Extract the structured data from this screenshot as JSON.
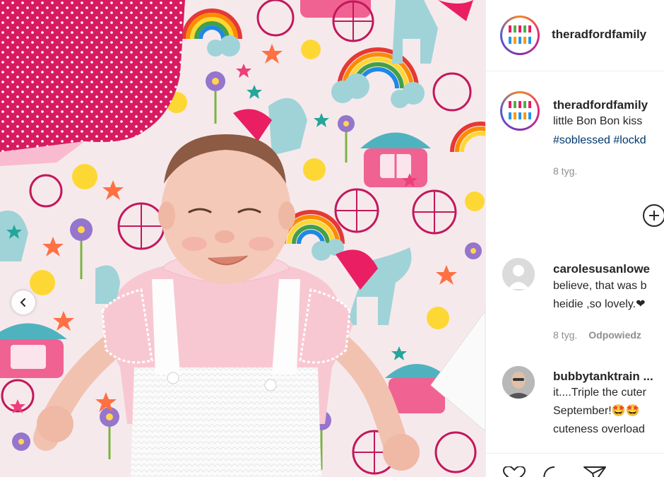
{
  "post": {
    "author": "theradfordfamily",
    "caption_lines": [
      "little Bon Bon kiss",
      ""
    ],
    "hashtags": [
      "#soblessed",
      "#lockd"
    ],
    "time": "8 tyg.",
    "load_more_label": "+"
  },
  "comments": [
    {
      "username": "carolesusanlowe",
      "lines": [
        "believe, that was b",
        "heidie ,so lovely.❤"
      ],
      "time": "8 tyg.",
      "reply_label": "Odpowiedz"
    },
    {
      "username": "bubbytanktrain ...",
      "lines": [
        "it....Triple the cuter",
        "September!🤩🤩",
        "cuteness overload"
      ]
    }
  ],
  "colors": {
    "heart": "#ed4956",
    "hashtag": "#00376b",
    "secondary_text": "#8e8e8e",
    "blanket": "#f6e9ec",
    "pillow": "#d81b60"
  },
  "icons": [
    "chevron-left-icon",
    "plus-icon",
    "heart-icon",
    "comment-icon",
    "share-icon"
  ]
}
